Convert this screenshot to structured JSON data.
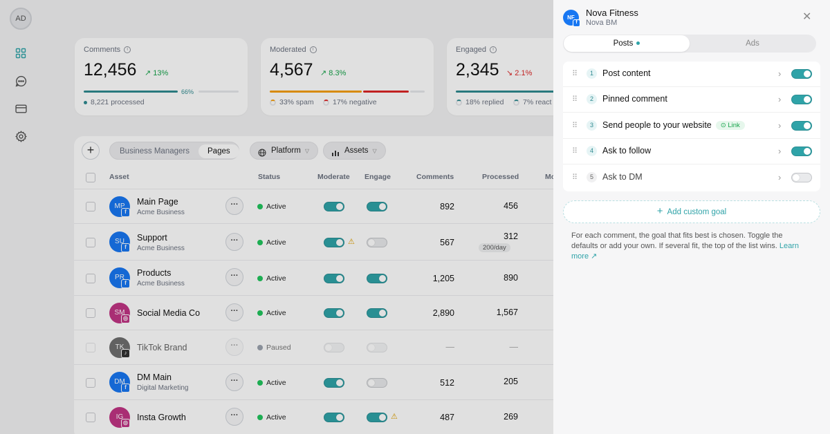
{
  "user": {
    "initials": "AD"
  },
  "nav": [
    "grid-icon",
    "chat-icon",
    "card-icon",
    "gear-icon"
  ],
  "stats": [
    {
      "label": "Comments",
      "value": "12,456",
      "delta": "↗ 13%",
      "bar_pct": "66%",
      "sub": "8,221 processed"
    },
    {
      "label": "Moderated",
      "value": "4,567",
      "delta": "↗ 8.3%",
      "sub1": "33% spam",
      "sub2": "17% negative"
    },
    {
      "label": "Engaged",
      "value": "2,345",
      "delta": "↘ 2.1%",
      "sub1": "18% replied",
      "sub2": "7% react"
    }
  ],
  "toolbar": {
    "tabs": [
      "Business Managers",
      "Pages"
    ],
    "platform": "Platform",
    "assets": "Assets"
  },
  "table": {
    "headers": [
      "Asset",
      "Status",
      "Moderate",
      "Engage",
      "Comments",
      "Processed",
      "Mo"
    ],
    "rows": [
      {
        "initials": "MP",
        "name": "Main Page",
        "org": "Acme Business",
        "status": "Active",
        "comments": "892",
        "processed": "456"
      },
      {
        "initials": "SU",
        "name": "Support",
        "org": "Acme Business",
        "status": "Active",
        "comments": "567",
        "processed": "312",
        "rate": "200/day"
      },
      {
        "initials": "PR",
        "name": "Products",
        "org": "Acme Business",
        "status": "Active",
        "comments": "1,205",
        "processed": "890"
      },
      {
        "initials": "SM",
        "name": "Social Media Co",
        "org": "",
        "status": "Active",
        "comments": "2,890",
        "processed": "1,567"
      },
      {
        "initials": "TK",
        "name": "TikTok Brand",
        "org": "",
        "status": "Paused",
        "comments": "—",
        "processed": "—"
      },
      {
        "initials": "DM",
        "name": "DM Main",
        "org": "Digital Marketing",
        "status": "Active",
        "comments": "512",
        "processed": "205"
      },
      {
        "initials": "IG",
        "name": "Insta Growth",
        "org": "",
        "status": "Active",
        "comments": "487",
        "processed": "269"
      }
    ]
  },
  "drawer": {
    "initials": "NF",
    "title": "Nova Fitness",
    "subtitle": "Nova BM",
    "tabs": [
      "Posts",
      "Ads"
    ],
    "goals": [
      {
        "n": "1",
        "label": "Post content",
        "on": true
      },
      {
        "n": "2",
        "label": "Pinned comment",
        "on": true
      },
      {
        "n": "3",
        "label": "Send people to your website",
        "badge": "Link",
        "on": true
      },
      {
        "n": "4",
        "label": "Ask to follow",
        "on": true
      },
      {
        "n": "5",
        "label": "Ask to DM",
        "on": false
      }
    ],
    "add_label": "Add custom goal",
    "help": "For each comment, the goal that fits best is chosen. Toggle the defaults or add your own. If several fit, the top of the list wins.",
    "learn_more": "Learn more"
  },
  "colors": {
    "accent": "#2fa3a8",
    "active": "#22c55e",
    "paused": "#9ca3af",
    "facebook": "#1877f2",
    "instagram": "#c13584",
    "tiktok": "#333333"
  }
}
